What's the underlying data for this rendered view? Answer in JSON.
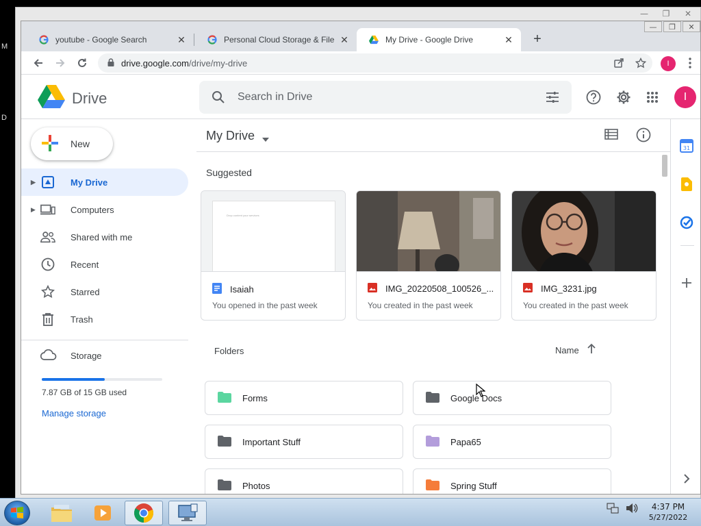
{
  "browser": {
    "tabs": [
      {
        "title": "youtube - Google Search",
        "favicon": "google-g-icon"
      },
      {
        "title": "Personal Cloud Storage & File Sh",
        "favicon": "google-g-icon"
      },
      {
        "title": "My Drive - Google Drive",
        "favicon": "drive-icon",
        "active": true
      }
    ],
    "url_host": "drive.google.com",
    "url_path": "/drive/my-drive",
    "profile_initial": "I"
  },
  "drive": {
    "app_name": "Drive",
    "search_placeholder": "Search in Drive",
    "avatar_initial": "I",
    "new_button": "New",
    "nav": [
      {
        "label": "My Drive",
        "icon": "my-drive-icon",
        "active": true,
        "expandable": true
      },
      {
        "label": "Computers",
        "icon": "computers-icon",
        "expandable": true
      },
      {
        "label": "Shared with me",
        "icon": "people-icon"
      },
      {
        "label": "Recent",
        "icon": "clock-icon"
      },
      {
        "label": "Starred",
        "icon": "star-icon"
      },
      {
        "label": "Trash",
        "icon": "trash-icon"
      }
    ],
    "storage": {
      "label": "Storage",
      "used_text": "7.87 GB of 15 GB used",
      "used_fraction": 0.525,
      "manage_label": "Manage storage"
    },
    "main_title": "My Drive",
    "suggested_label": "Suggested",
    "suggested": [
      {
        "name": "Isaiah",
        "sub": "You opened in the past week",
        "type": "doc",
        "preview_text": "Drop content your services"
      },
      {
        "name": "IMG_20220508_100526_...",
        "sub": "You created in the past week",
        "type": "image"
      },
      {
        "name": "IMG_3231.jpg",
        "sub": "You created in the past week",
        "type": "image"
      }
    ],
    "folders_label": "Folders",
    "sort_label": "Name",
    "folders": [
      {
        "name": "Forms",
        "color": "#5bd6a0"
      },
      {
        "name": "Google Docs",
        "color": "#5f6368"
      },
      {
        "name": "Important Stuff",
        "color": "#5f6368"
      },
      {
        "name": "Papa65",
        "color": "#b39ddb"
      },
      {
        "name": "Photos",
        "color": "#5f6368"
      },
      {
        "name": "Spring Stuff",
        "color": "#f57c3a"
      }
    ]
  },
  "taskbar": {
    "apps": [
      "file-explorer-icon",
      "media-player-icon",
      "chrome-icon",
      "remote-desktop-icon"
    ],
    "time": "4:37 PM",
    "date": "5/27/2022"
  },
  "colors": {
    "accent": "#1a73e8",
    "active_nav_bg": "#e8f0fe",
    "avatar": "#e52570"
  }
}
